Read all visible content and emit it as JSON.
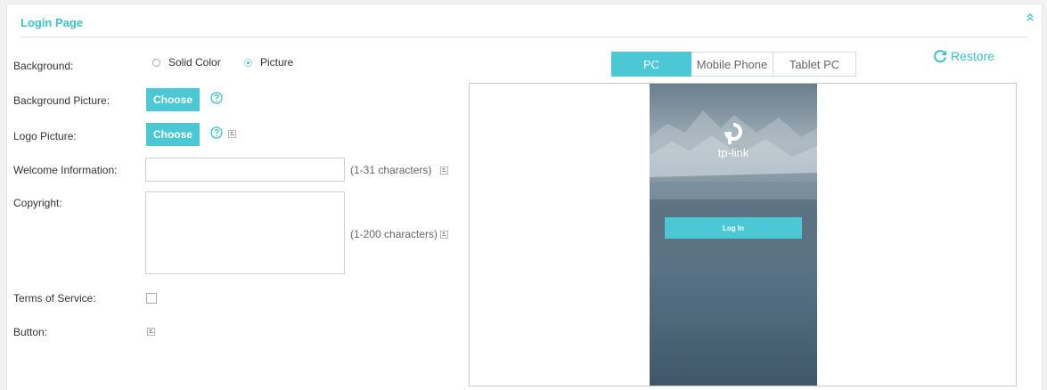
{
  "panel": {
    "title": "Login Page"
  },
  "form": {
    "background": {
      "label": "Background:",
      "options": [
        "Solid Color",
        "Picture"
      ],
      "selected": "Picture"
    },
    "background_picture": {
      "label": "Background Picture:",
      "button": "Choose"
    },
    "logo_picture": {
      "label": "Logo Picture:",
      "button": "Choose"
    },
    "welcome": {
      "label": "Welcome Information:",
      "value": "",
      "hint": "(1-31 characters)"
    },
    "copyright": {
      "label": "Copyright:",
      "value": "",
      "hint": "(1-200 characters)"
    },
    "terms": {
      "label": "Terms of Service:",
      "checked": false
    },
    "button": {
      "label": "Button:"
    }
  },
  "preview": {
    "tabs": [
      "PC",
      "Mobile Phone",
      "Tablet PC"
    ],
    "active_tab": "PC",
    "restore_label": "Restore",
    "brand": "tp-link",
    "login_label": "Log In"
  },
  "colors": {
    "accent": "#4bc8d3",
    "title": "#3bc1cc"
  },
  "icons": {
    "collapse": "double-chevron-up-icon",
    "help": "question-circle-icon",
    "expand": "dropdown-expand-icon",
    "restore": "refresh-icon"
  }
}
